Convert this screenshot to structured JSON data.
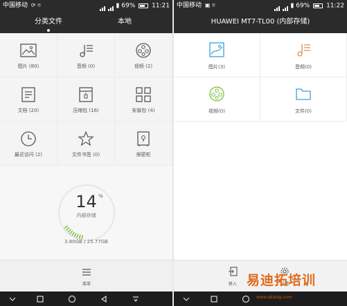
{
  "left_screen": {
    "statusbar": {
      "carrier": "中国移动",
      "battery": "69%",
      "time": "11:21"
    },
    "tabs": [
      {
        "label": "分类文件"
      },
      {
        "label": "本地"
      }
    ],
    "categories": [
      {
        "label": "图片 (80)",
        "icon": "image-icon"
      },
      {
        "label": "音频 (0)",
        "icon": "music-icon"
      },
      {
        "label": "视频 (2)",
        "icon": "film-reel-icon"
      },
      {
        "label": "文档 (20)",
        "icon": "document-icon"
      },
      {
        "label": "压缩包 (16)",
        "icon": "archive-icon"
      },
      {
        "label": "安装包 (4)",
        "icon": "apps-grid-icon"
      },
      {
        "label": "最近访问 (2)",
        "icon": "clock-icon"
      },
      {
        "label": "文件书签 (0)",
        "icon": "star-icon"
      },
      {
        "label": "保密柜",
        "icon": "safe-icon"
      }
    ],
    "storage": {
      "percent": "14",
      "percent_sign": "%",
      "label": "内部存储",
      "capacity": "3.80GB / 25.77GB",
      "used_fraction": 0.14
    },
    "bottom": {
      "menu_label": "菜单"
    }
  },
  "right_screen": {
    "statusbar": {
      "carrier": "中国移动",
      "battery": "69%",
      "time": "11:22"
    },
    "title": "HUAWEI MT7-TL00 (内部存储)",
    "categories": [
      {
        "label": "图片(3)",
        "icon": "image-icon"
      },
      {
        "label": "音频(0)",
        "icon": "music-icon"
      },
      {
        "label": "视频(0)",
        "icon": "film-reel-icon"
      },
      {
        "label": "文件(0)",
        "icon": "folder-icon"
      }
    ],
    "bottom": {
      "move_in_label": "移入",
      "settings_label": "设置"
    }
  },
  "watermark": {
    "text": "易迪拓培训",
    "url": "www.edatop.com"
  },
  "colors": {
    "bar_dark": "#2b2b2b",
    "accent_green": "#7cbf3f",
    "accent_blue": "#3aa0d8",
    "accent_orange": "#e08a4a",
    "watermark": "#e06a1b"
  }
}
